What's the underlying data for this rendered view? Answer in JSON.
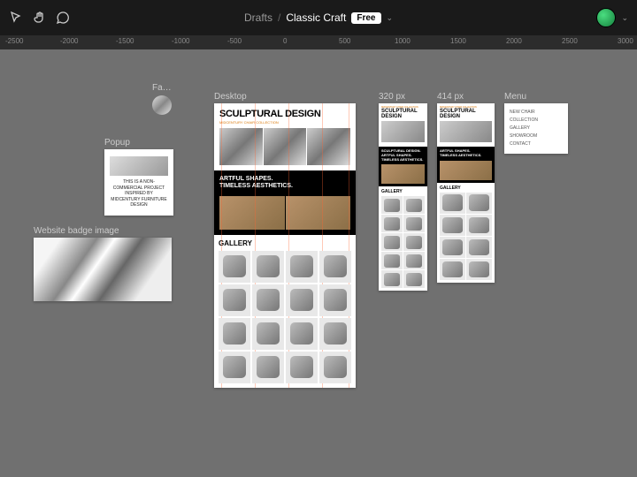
{
  "topbar": {
    "drafts": "Drafts",
    "slash": "/",
    "filename": "Classic Craft",
    "badge": "Free",
    "chevron": "⌄"
  },
  "ruler": {
    "ticks": [
      "-2500",
      "-2000",
      "-1500",
      "-1000",
      "-500",
      "0",
      "500",
      "1000",
      "1500",
      "2000",
      "2500",
      "3000"
    ]
  },
  "frames": {
    "fa": "Fa…",
    "popup_label": "Popup",
    "popup_text": "THIS IS A NON-COMMERCIAL PROJECT INSPIRED BY MIDCENTURY FURNITURE DESIGN",
    "badge_label": "Website badge image",
    "menu_label": "Menu",
    "menu_items": [
      "NEW CHAIR COLLECTION",
      "GALLERY",
      "SHOWROOM",
      "CONTACT"
    ],
    "desktop_label": "Desktop",
    "m320_label": "320 px",
    "m414_label": "414 px"
  },
  "site": {
    "h1": "SCULPTURAL DESIGN",
    "sub": "MIDCENTURY CHAIR COLLECTION",
    "dark1": "ARTFUL SHAPES.",
    "dark2": "TIMELESS AESTHETICS.",
    "gallery": "GALLERY",
    "m320_h": "SCULPTURAL DESIGN",
    "m320_dark": "SCULPTURAL DESIGN. ARTFUL SHAPES. TIMELESS AESTHETICS."
  }
}
